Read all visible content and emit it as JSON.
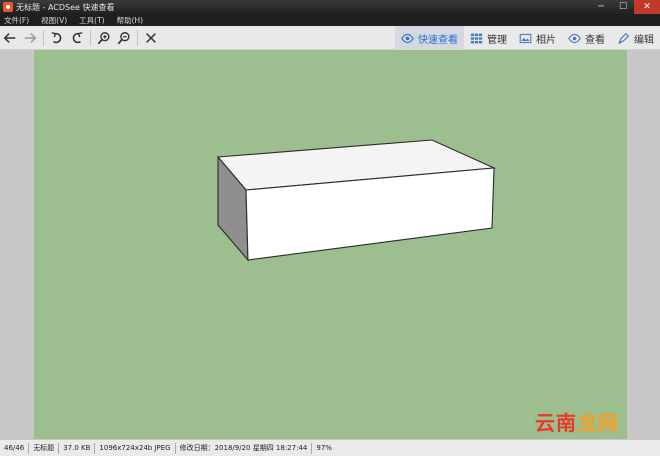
{
  "window": {
    "title": "无标题 - ACDSee 快速查看",
    "controls": {
      "minimize": "─",
      "maximize": "☐",
      "close": "✕"
    }
  },
  "menu": {
    "items": [
      "文件(F)",
      "视图(V)",
      "工具(T)",
      "帮助(H)"
    ]
  },
  "toolbar": {
    "buttons": [
      "back-icon",
      "forward-icon",
      "rotate-left-icon",
      "rotate-right-icon",
      "zoom-in-icon",
      "zoom-out-icon",
      "close-icon"
    ]
  },
  "modes": [
    {
      "label": "快速查看",
      "icon": "eye-icon",
      "active": true
    },
    {
      "label": "管理",
      "icon": "grid-icon",
      "active": false
    },
    {
      "label": "相片",
      "icon": "photo-icon",
      "active": false
    },
    {
      "label": "查看",
      "icon": "eye-icon",
      "active": false
    },
    {
      "label": "编辑",
      "icon": "edit-icon",
      "active": false
    }
  ],
  "colors": {
    "canvas": "#9dbf8f",
    "active_mode": "#2a6fd1",
    "watermark_a": "#e8392b",
    "watermark_b": "#f2a026"
  },
  "watermark": {
    "part_a": "云南",
    "part_b": "龙网"
  },
  "status": {
    "index": "46/46",
    "filename": "无标题",
    "size": "37.0 KB",
    "dimensions": "1096x724x24b JPEG",
    "modified": "修改日期：2018/9/20 星期四 18:27:44",
    "zoom": "97%"
  }
}
